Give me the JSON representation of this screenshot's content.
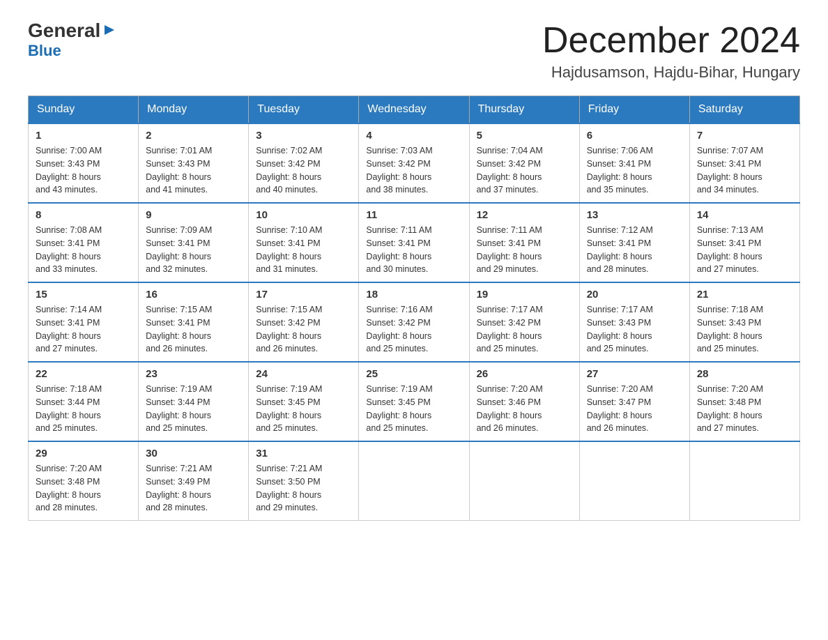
{
  "header": {
    "logo_general": "General",
    "logo_blue": "Blue",
    "month_title": "December 2024",
    "location": "Hajdusamson, Hajdu-Bihar, Hungary"
  },
  "weekdays": [
    "Sunday",
    "Monday",
    "Tuesday",
    "Wednesday",
    "Thursday",
    "Friday",
    "Saturday"
  ],
  "weeks": [
    [
      {
        "day": "1",
        "sunrise": "7:00 AM",
        "sunset": "3:43 PM",
        "daylight": "8 hours and 43 minutes."
      },
      {
        "day": "2",
        "sunrise": "7:01 AM",
        "sunset": "3:43 PM",
        "daylight": "8 hours and 41 minutes."
      },
      {
        "day": "3",
        "sunrise": "7:02 AM",
        "sunset": "3:42 PM",
        "daylight": "8 hours and 40 minutes."
      },
      {
        "day": "4",
        "sunrise": "7:03 AM",
        "sunset": "3:42 PM",
        "daylight": "8 hours and 38 minutes."
      },
      {
        "day": "5",
        "sunrise": "7:04 AM",
        "sunset": "3:42 PM",
        "daylight": "8 hours and 37 minutes."
      },
      {
        "day": "6",
        "sunrise": "7:06 AM",
        "sunset": "3:41 PM",
        "daylight": "8 hours and 35 minutes."
      },
      {
        "day": "7",
        "sunrise": "7:07 AM",
        "sunset": "3:41 PM",
        "daylight": "8 hours and 34 minutes."
      }
    ],
    [
      {
        "day": "8",
        "sunrise": "7:08 AM",
        "sunset": "3:41 PM",
        "daylight": "8 hours and 33 minutes."
      },
      {
        "day": "9",
        "sunrise": "7:09 AM",
        "sunset": "3:41 PM",
        "daylight": "8 hours and 32 minutes."
      },
      {
        "day": "10",
        "sunrise": "7:10 AM",
        "sunset": "3:41 PM",
        "daylight": "8 hours and 31 minutes."
      },
      {
        "day": "11",
        "sunrise": "7:11 AM",
        "sunset": "3:41 PM",
        "daylight": "8 hours and 30 minutes."
      },
      {
        "day": "12",
        "sunrise": "7:11 AM",
        "sunset": "3:41 PM",
        "daylight": "8 hours and 29 minutes."
      },
      {
        "day": "13",
        "sunrise": "7:12 AM",
        "sunset": "3:41 PM",
        "daylight": "8 hours and 28 minutes."
      },
      {
        "day": "14",
        "sunrise": "7:13 AM",
        "sunset": "3:41 PM",
        "daylight": "8 hours and 27 minutes."
      }
    ],
    [
      {
        "day": "15",
        "sunrise": "7:14 AM",
        "sunset": "3:41 PM",
        "daylight": "8 hours and 27 minutes."
      },
      {
        "day": "16",
        "sunrise": "7:15 AM",
        "sunset": "3:41 PM",
        "daylight": "8 hours and 26 minutes."
      },
      {
        "day": "17",
        "sunrise": "7:15 AM",
        "sunset": "3:42 PM",
        "daylight": "8 hours and 26 minutes."
      },
      {
        "day": "18",
        "sunrise": "7:16 AM",
        "sunset": "3:42 PM",
        "daylight": "8 hours and 25 minutes."
      },
      {
        "day": "19",
        "sunrise": "7:17 AM",
        "sunset": "3:42 PM",
        "daylight": "8 hours and 25 minutes."
      },
      {
        "day": "20",
        "sunrise": "7:17 AM",
        "sunset": "3:43 PM",
        "daylight": "8 hours and 25 minutes."
      },
      {
        "day": "21",
        "sunrise": "7:18 AM",
        "sunset": "3:43 PM",
        "daylight": "8 hours and 25 minutes."
      }
    ],
    [
      {
        "day": "22",
        "sunrise": "7:18 AM",
        "sunset": "3:44 PM",
        "daylight": "8 hours and 25 minutes."
      },
      {
        "day": "23",
        "sunrise": "7:19 AM",
        "sunset": "3:44 PM",
        "daylight": "8 hours and 25 minutes."
      },
      {
        "day": "24",
        "sunrise": "7:19 AM",
        "sunset": "3:45 PM",
        "daylight": "8 hours and 25 minutes."
      },
      {
        "day": "25",
        "sunrise": "7:19 AM",
        "sunset": "3:45 PM",
        "daylight": "8 hours and 25 minutes."
      },
      {
        "day": "26",
        "sunrise": "7:20 AM",
        "sunset": "3:46 PM",
        "daylight": "8 hours and 26 minutes."
      },
      {
        "day": "27",
        "sunrise": "7:20 AM",
        "sunset": "3:47 PM",
        "daylight": "8 hours and 26 minutes."
      },
      {
        "day": "28",
        "sunrise": "7:20 AM",
        "sunset": "3:48 PM",
        "daylight": "8 hours and 27 minutes."
      }
    ],
    [
      {
        "day": "29",
        "sunrise": "7:20 AM",
        "sunset": "3:48 PM",
        "daylight": "8 hours and 28 minutes."
      },
      {
        "day": "30",
        "sunrise": "7:21 AM",
        "sunset": "3:49 PM",
        "daylight": "8 hours and 28 minutes."
      },
      {
        "day": "31",
        "sunrise": "7:21 AM",
        "sunset": "3:50 PM",
        "daylight": "8 hours and 29 minutes."
      },
      null,
      null,
      null,
      null
    ]
  ],
  "labels": {
    "sunrise": "Sunrise:",
    "sunset": "Sunset:",
    "daylight": "Daylight:"
  }
}
